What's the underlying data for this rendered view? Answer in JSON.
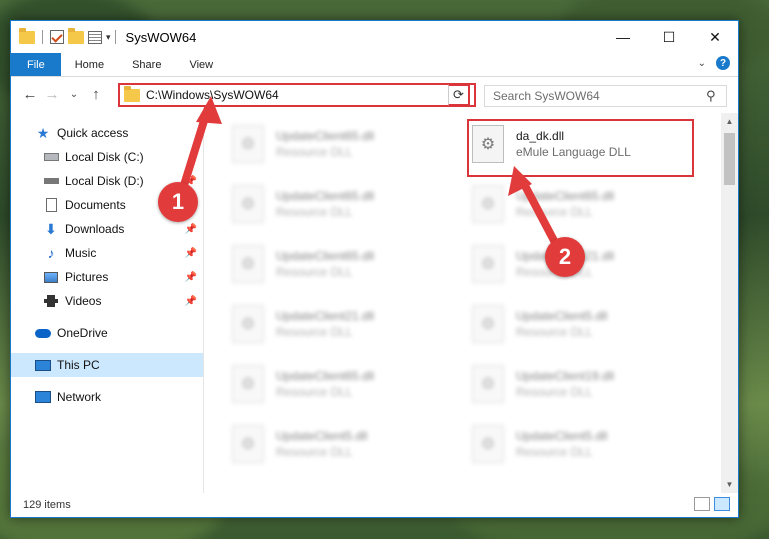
{
  "window": {
    "title": "SysWOW64",
    "controls": {
      "minimize": "—",
      "maximize": "☐",
      "close": "✕"
    }
  },
  "ribbon": {
    "tabs": [
      "File",
      "Home",
      "Share",
      "View"
    ],
    "help": "?"
  },
  "nav": {
    "address": "C:\\Windows\\SysWOW64",
    "search_placeholder": "Search SysWOW64"
  },
  "sidebar": {
    "quick_access": "Quick access",
    "items": [
      {
        "label": "Local Disk (C:)",
        "icon": "local-disk-icon"
      },
      {
        "label": "Local Disk (D:)",
        "icon": "local-disk-icon"
      },
      {
        "label": "Documents",
        "icon": "documents-icon"
      },
      {
        "label": "Downloads",
        "icon": "downloads-icon"
      },
      {
        "label": "Music",
        "icon": "music-icon"
      },
      {
        "label": "Pictures",
        "icon": "pictures-icon"
      },
      {
        "label": "Videos",
        "icon": "videos-icon"
      }
    ],
    "onedrive": "OneDrive",
    "this_pc": "This PC",
    "network": "Network"
  },
  "files": {
    "highlighted": {
      "name": "da_dk.dll",
      "desc": "eMule Language DLL"
    },
    "left_column": [
      {
        "name": "UpdateClient65.dll",
        "desc": "Resource DLL"
      },
      {
        "name": "UpdateClient65.dll",
        "desc": "Resource DLL"
      },
      {
        "name": "UpdateClient65.dll",
        "desc": "Resource DLL"
      },
      {
        "name": "UpdateClient21.dll",
        "desc": "Resource DLL"
      },
      {
        "name": "UpdateClient65.dll",
        "desc": "Resource DLL"
      },
      {
        "name": "UpdateClient5.dll",
        "desc": "Resource DLL"
      }
    ],
    "right_column": [
      {
        "name": "UpdateClient65.dll",
        "desc": "Resource DLL"
      },
      {
        "name": "UpdateClient21.dll",
        "desc": "Resource DLL"
      },
      {
        "name": "UpdateClient5.dll",
        "desc": "Resource DLL"
      },
      {
        "name": "UpdateClient19.dll",
        "desc": "Resource DLL"
      },
      {
        "name": "UpdateClient5.dll",
        "desc": "Resource DLL"
      }
    ]
  },
  "status": {
    "count": "129 items"
  },
  "callouts": {
    "one": "1",
    "two": "2"
  },
  "colors": {
    "accent": "#1979ca",
    "highlight": "#d9353a",
    "selection": "#cce8ff"
  }
}
